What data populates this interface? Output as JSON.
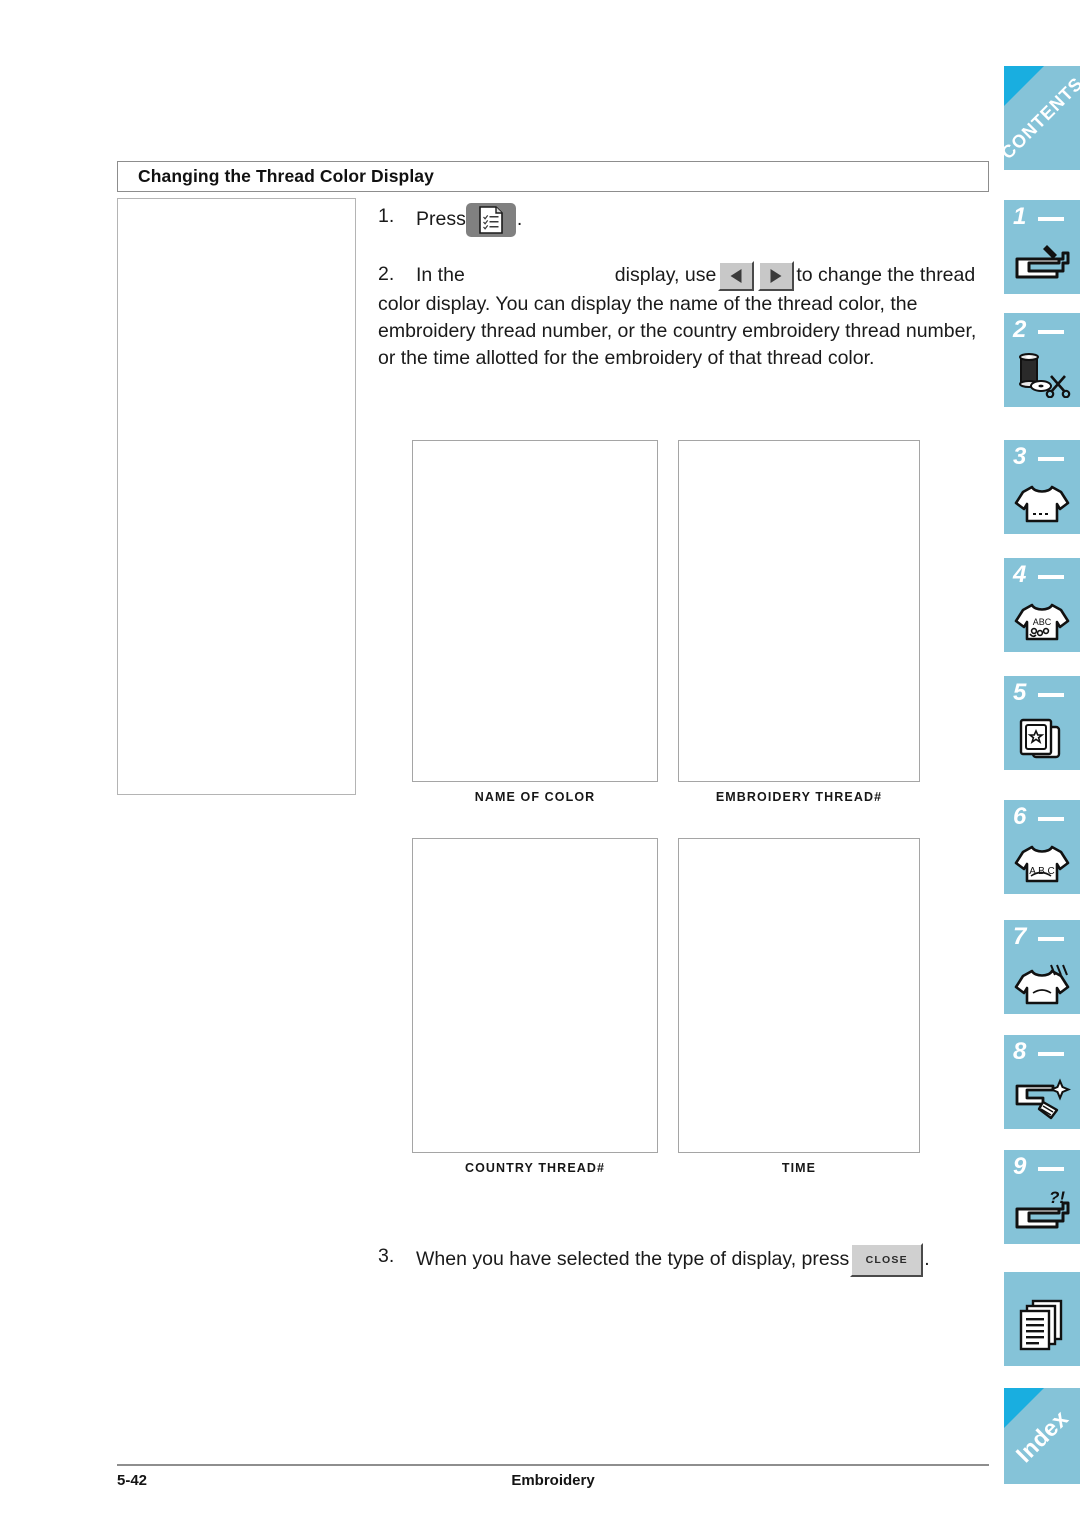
{
  "document": {
    "section_heading": "Changing the Thread Color Display",
    "footer": {
      "page_number": "5-42",
      "chapter_title": "Embroidery"
    }
  },
  "steps": [
    {
      "number": "1.",
      "text_before": "Press",
      "button": {
        "name": "thread-list-button",
        "icon": "document-checklist-icon",
        "label": ""
      },
      "text_after": "."
    },
    {
      "number": "2.",
      "text_before": "In the",
      "text_middle": "display, use",
      "buttons": [
        {
          "name": "previous-arrow-button",
          "icon": "triangle-left-icon",
          "label": "◄"
        },
        {
          "name": "next-arrow-button",
          "icon": "triangle-right-icon",
          "label": "►"
        }
      ],
      "text_after": "to change the thread color display. You can display the name of the thread color, the embroidery thread number, or the country embroidery thread number, or the time allotted for the embroidery of that thread color."
    },
    {
      "number": "3.",
      "text_before": "When you have selected the type of display, press",
      "button": {
        "name": "close-button",
        "icon": "",
        "label": "CLOSE"
      },
      "text_after": "."
    }
  ],
  "figure_grid": [
    {
      "caption": "NAME OF COLOR"
    },
    {
      "caption": "EMBROIDERY THREAD#"
    },
    {
      "caption": "COUNTRY THREAD#"
    },
    {
      "caption": "TIME"
    }
  ],
  "tabstrip": {
    "accent_color": "#85c3d8",
    "fold_color": "#19aee0",
    "tabs": [
      {
        "id": "contents",
        "type": "fold",
        "label": "CONTENTS",
        "icon": ""
      },
      {
        "id": "ch1",
        "type": "numbered",
        "label": "1",
        "icon": "sewing-machine-icon"
      },
      {
        "id": "ch2",
        "type": "numbered",
        "label": "2",
        "icon": "thread-spool-bobbin-scissors-icon"
      },
      {
        "id": "ch3",
        "type": "numbered",
        "label": "3",
        "icon": "tshirt-stitch-icon"
      },
      {
        "id": "ch4",
        "type": "numbered",
        "label": "4",
        "icon": "tshirt-abc-embroidery-icon"
      },
      {
        "id": "ch5",
        "type": "numbered",
        "label": "5",
        "icon": "embroidery-card-star-icon"
      },
      {
        "id": "ch6",
        "type": "numbered",
        "label": "6",
        "icon": "tshirt-lettering-icon"
      },
      {
        "id": "ch7",
        "type": "numbered",
        "label": "7",
        "icon": "tshirt-care-icon"
      },
      {
        "id": "ch8",
        "type": "numbered",
        "label": "8",
        "icon": "machine-cleaning-icon"
      },
      {
        "id": "ch9",
        "type": "numbered",
        "label": "9",
        "icon": "machine-troubleshooting-icon"
      },
      {
        "id": "appendix",
        "type": "plain",
        "label": "",
        "icon": "stacked-documents-icon"
      },
      {
        "id": "index",
        "type": "fold",
        "label": "Index",
        "icon": ""
      }
    ]
  }
}
